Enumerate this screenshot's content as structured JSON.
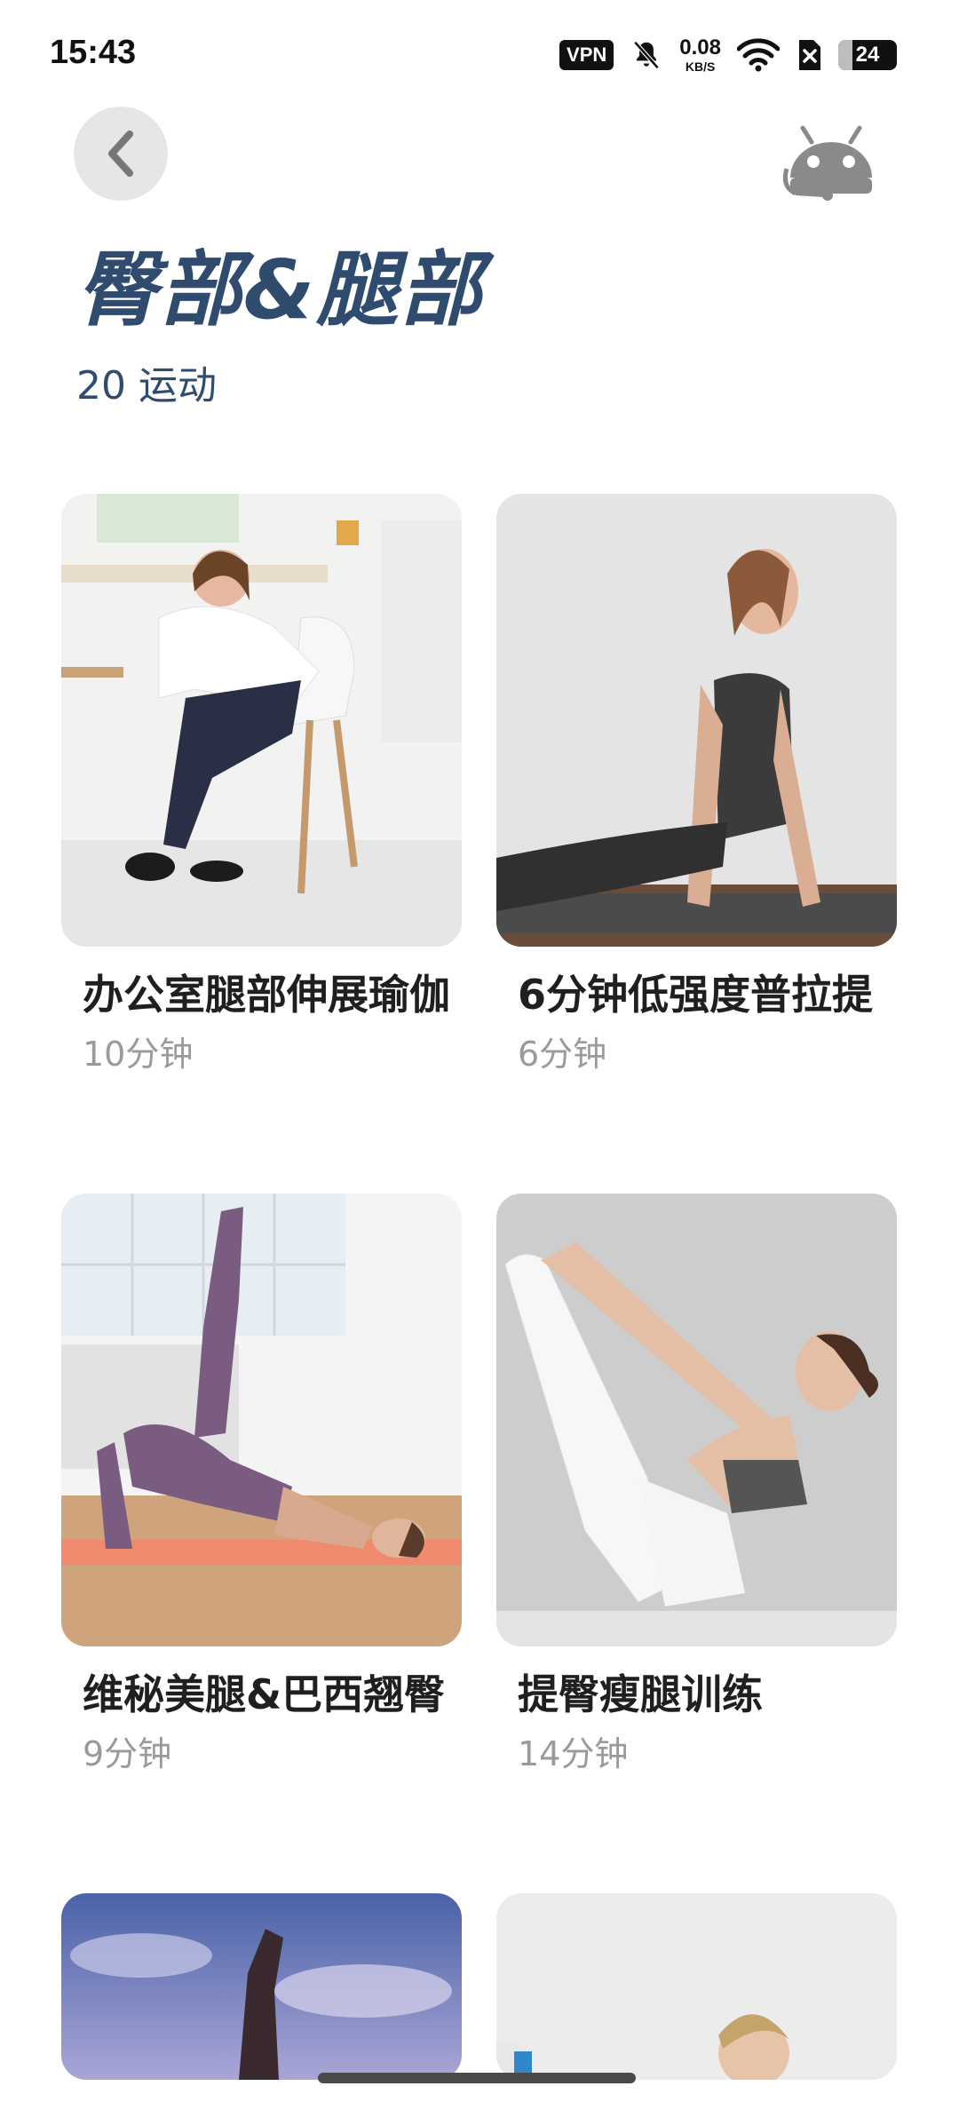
{
  "status_bar": {
    "time": "15:43",
    "vpn": "VPN",
    "net_speed": "0.08",
    "net_unit": "KB/S",
    "battery": "24",
    "battery_level": 0.24
  },
  "header": {
    "title": "臀部&腿部",
    "subtitle": "20 运动"
  },
  "workouts": [
    {
      "title": "办公室腿部伸展瑜伽",
      "duration": "10分钟"
    },
    {
      "title": "6分钟低强度普拉提",
      "duration": "6分钟"
    },
    {
      "title": "维秘美腿&巴西翘臀",
      "duration": "9分钟"
    },
    {
      "title": "提臀瘦腿训练",
      "duration": "14分钟"
    }
  ],
  "colors": {
    "title": "#2f4b6e",
    "card_title": "#1f1f1f",
    "duration": "#9a9a9a"
  }
}
